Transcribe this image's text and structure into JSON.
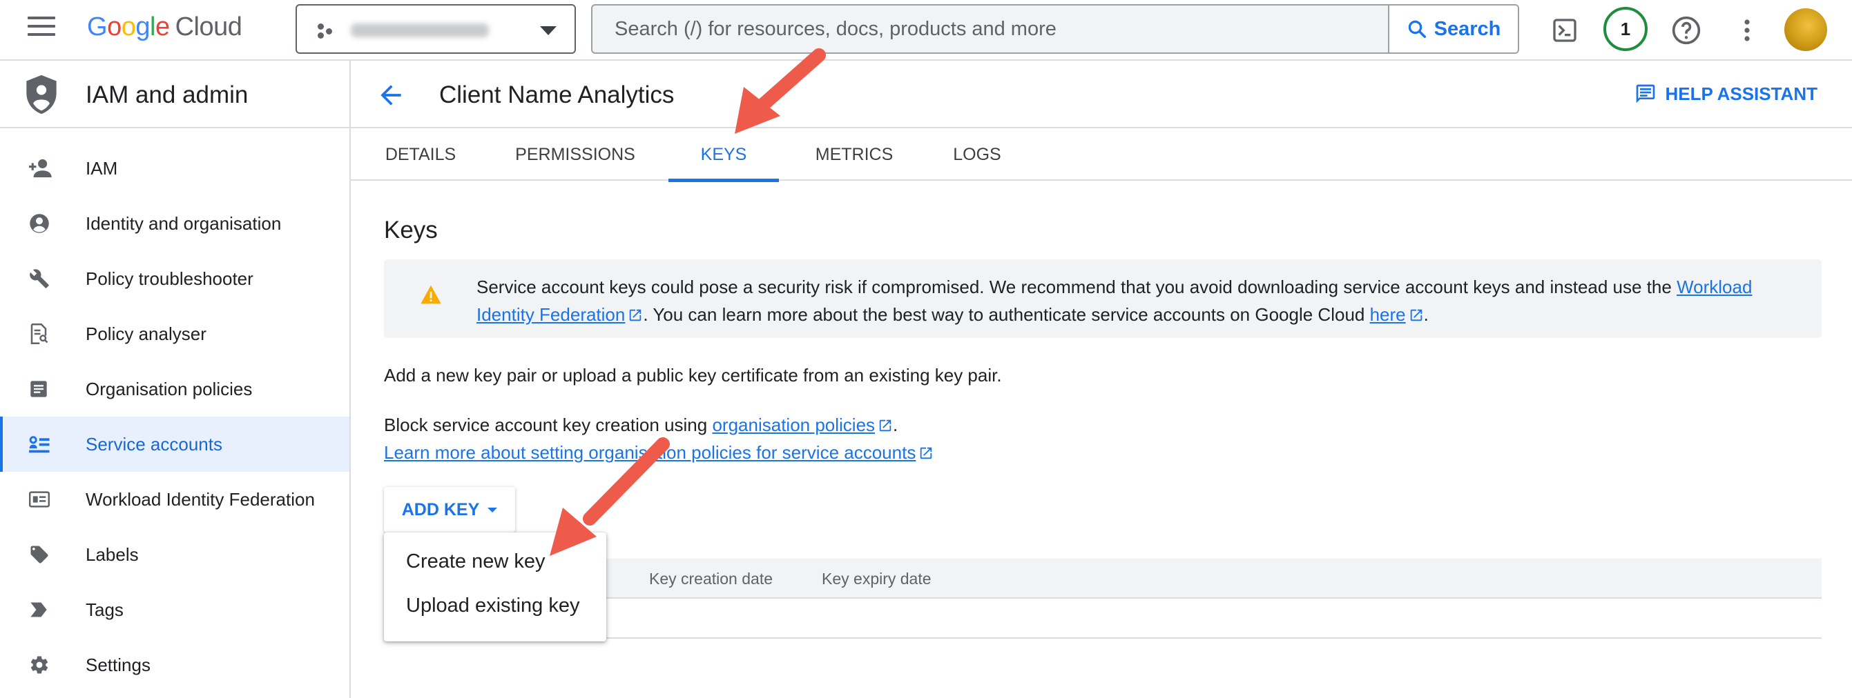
{
  "topbar": {
    "logo_google": [
      "G",
      "o",
      "o",
      "g",
      "l",
      "e"
    ],
    "logo_cloud": "Cloud",
    "search_placeholder": "Search (/) for resources, docs, products and more",
    "search_button": "Search",
    "notification_count": "1",
    "icons": [
      "menu-icon",
      "project-icon",
      "terminal-icon",
      "help-icon",
      "more-vert-icon",
      "avatar"
    ]
  },
  "sidebar": {
    "title": "IAM and admin",
    "items": [
      {
        "label": "IAM",
        "icon": "person-add-icon",
        "active": false
      },
      {
        "label": "Identity and organisation",
        "icon": "account-circle-icon",
        "active": false
      },
      {
        "label": "Policy troubleshooter",
        "icon": "wrench-icon",
        "active": false
      },
      {
        "label": "Policy analyser",
        "icon": "document-search-icon",
        "active": false
      },
      {
        "label": "Organisation policies",
        "icon": "article-icon",
        "active": false
      },
      {
        "label": "Service accounts",
        "icon": "service-account-icon",
        "active": true
      },
      {
        "label": "Workload Identity Federation",
        "icon": "id-card-icon",
        "active": false
      },
      {
        "label": "Labels",
        "icon": "label-icon",
        "active": false
      },
      {
        "label": "Tags",
        "icon": "tag-icon",
        "active": false
      },
      {
        "label": "Settings",
        "icon": "gear-icon",
        "active": false
      }
    ]
  },
  "header": {
    "title": "Client Name Analytics",
    "help_assistant": "HELP ASSISTANT"
  },
  "tabs": [
    {
      "label": "DETAILS",
      "active": false
    },
    {
      "label": "PERMISSIONS",
      "active": false
    },
    {
      "label": "KEYS",
      "active": true
    },
    {
      "label": "METRICS",
      "active": false
    },
    {
      "label": "LOGS",
      "active": false
    }
  ],
  "keys": {
    "title": "Keys",
    "warning": {
      "part1": "Service account keys could pose a security risk if compromised. We recommend that you avoid downloading service account keys and instead use the ",
      "link1a": "Workload",
      "link1b": "Identity Federation",
      "part2": ". You can learn more about the best way to authenticate service accounts on Google Cloud ",
      "link2": "here",
      "part3": "."
    },
    "add_pair_text": "Add a new key pair or upload a public key certificate from an existing key pair.",
    "block_text": "Block service account key creation using ",
    "block_link": "organisation policies",
    "block_period": ".",
    "learn_more": "Learn more about setting organisation policies for service accounts",
    "add_key_button": "ADD KEY",
    "table_columns": [
      "Key creation date",
      "Key expiry date"
    ],
    "menu": [
      "Create new key",
      "Upload existing key"
    ]
  },
  "colors": {
    "accent": "#1a73e8",
    "active_bg": "#e8f0fe",
    "warning": "#f9ab00",
    "annotation_arrow": "#ef5b4b"
  }
}
